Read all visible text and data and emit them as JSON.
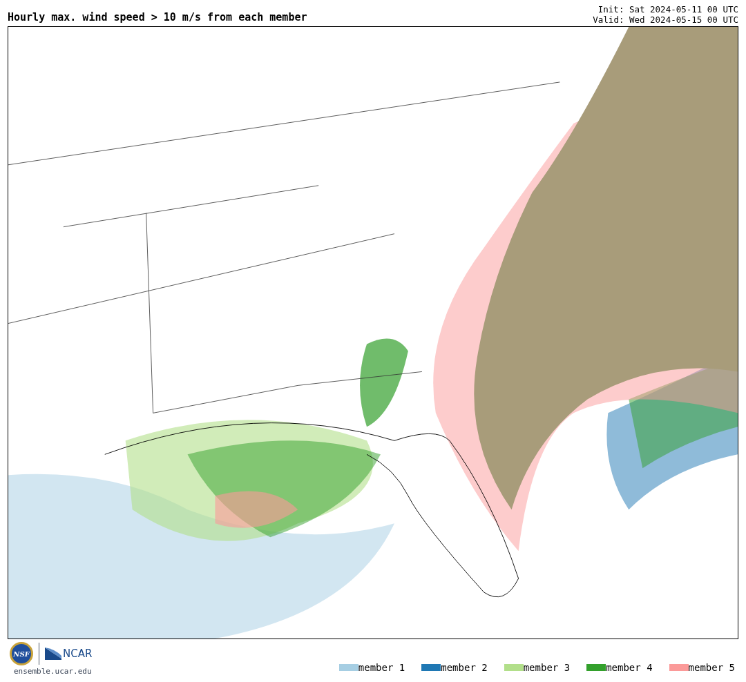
{
  "title": "Hourly max. wind speed > 10 m/s from each member",
  "init": "Init: Sat 2024-05-11 00 UTC",
  "valid": "Valid: Wed 2024-05-15 00 UTC",
  "logos": {
    "nsf": "NSF",
    "ncar": "NCAR"
  },
  "site": "ensemble.ucar.edu",
  "legend": [
    {
      "label": "member 1",
      "color": "#a6cee3"
    },
    {
      "label": "member 2",
      "color": "#1f78b4"
    },
    {
      "label": "member 3",
      "color": "#b2df8a"
    },
    {
      "label": "member 4",
      "color": "#33a02c"
    },
    {
      "label": "member 5",
      "color": "#fb9a99"
    }
  ]
}
